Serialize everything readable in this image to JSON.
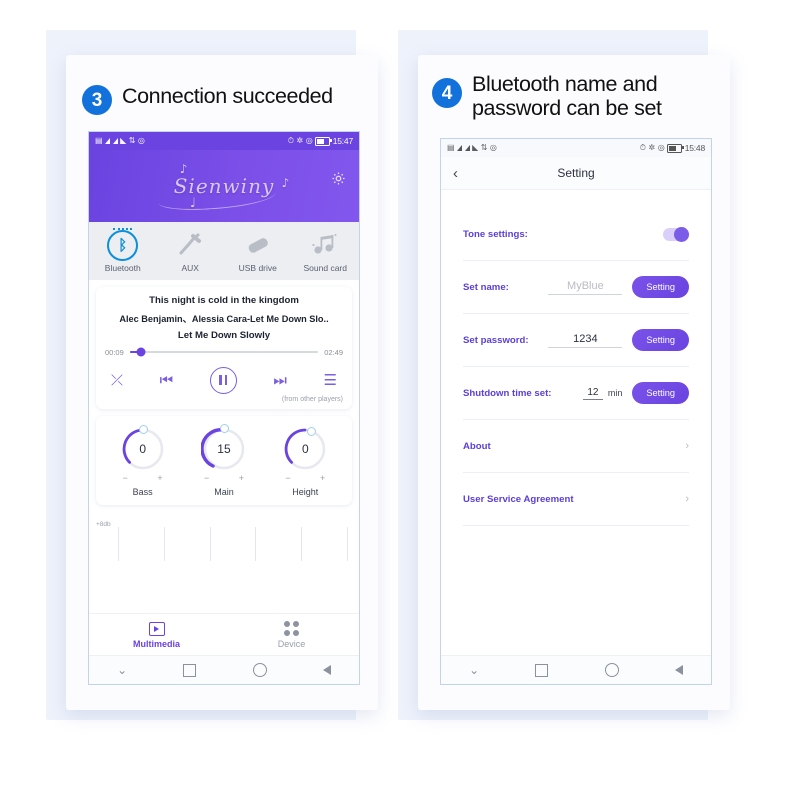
{
  "panels": [
    {
      "badge": "3",
      "caption": "Connection succeeded",
      "status": {
        "time": "15:47",
        "icons": [
          "sim-card-icon",
          "signal-bars-icon",
          "signal-bars-icon",
          "wifi-icon",
          "data-transfer-icon",
          "location-icon"
        ],
        "right_icons": [
          "alarm-icon",
          "bluetooth-icon",
          "location-icon",
          "battery-icon"
        ]
      },
      "hero": {
        "logo_text": "Sienwiny",
        "gear": "gear-icon"
      },
      "sources": [
        {
          "label": "Bluetooth",
          "icon": "bluetooth-icon",
          "active": true
        },
        {
          "label": "AUX",
          "icon": "aux-plug-icon",
          "active": false
        },
        {
          "label": "USB drive",
          "icon": "usb-drive-icon",
          "active": false
        },
        {
          "label": "Sound card",
          "icon": "music-notes-icon",
          "active": false
        }
      ],
      "player": {
        "line1": "This night is cold in the kingdom",
        "line2": "Alec Benjamin、Alessia Cara-Let Me Down Slo..",
        "line3": "Let Me Down Slowly",
        "elapsed": "00:09",
        "total": "02:49",
        "progress_percent": 6,
        "from_note": "(from other players)",
        "controls": [
          "shuffle-icon",
          "previous-icon",
          "pause-icon",
          "next-icon",
          "playlist-icon"
        ]
      },
      "knobs": [
        {
          "label": "Bass",
          "value": "0"
        },
        {
          "label": "Main",
          "value": "15"
        },
        {
          "label": "Height",
          "value": "0"
        }
      ],
      "eq": {
        "db_label": "+8db",
        "gridlines": 6
      },
      "tabs": [
        {
          "label": "Multimedia",
          "icon": "media-play-icon",
          "active": true
        },
        {
          "label": "Device",
          "icon": "grid-dots-icon",
          "active": false
        }
      ],
      "navbar": [
        "chevron-down-icon",
        "square-icon",
        "circle-icon",
        "back-triangle-icon"
      ]
    },
    {
      "badge": "4",
      "caption_line1": "Bluetooth name and",
      "caption_line2": "password can be set",
      "status": {
        "time": "15:48"
      },
      "titlebar": {
        "back": "back-chevron-icon",
        "title": "Setting"
      },
      "rows": [
        {
          "type": "toggle",
          "label": "Tone settings:",
          "on": true
        },
        {
          "type": "input",
          "label": "Set name:",
          "value": "MyBlue",
          "is_placeholder": true,
          "button": "Setting"
        },
        {
          "type": "input",
          "label": "Set password:",
          "value": "1234",
          "is_placeholder": false,
          "button": "Setting"
        },
        {
          "type": "time",
          "label": "Shutdown time set:",
          "value": "12",
          "unit": "min",
          "button": "Setting"
        },
        {
          "type": "link",
          "label": "About"
        },
        {
          "type": "link",
          "label": "User Service Agreement"
        }
      ],
      "navbar": [
        "chevron-down-icon",
        "square-icon",
        "circle-icon",
        "back-triangle-icon"
      ]
    }
  ],
  "colors": {
    "accent_purple": "#6a43e0",
    "badge_blue": "#1271db",
    "bluetooth_blue": "#0d8fdb",
    "backdrop": "#eef2fb"
  }
}
